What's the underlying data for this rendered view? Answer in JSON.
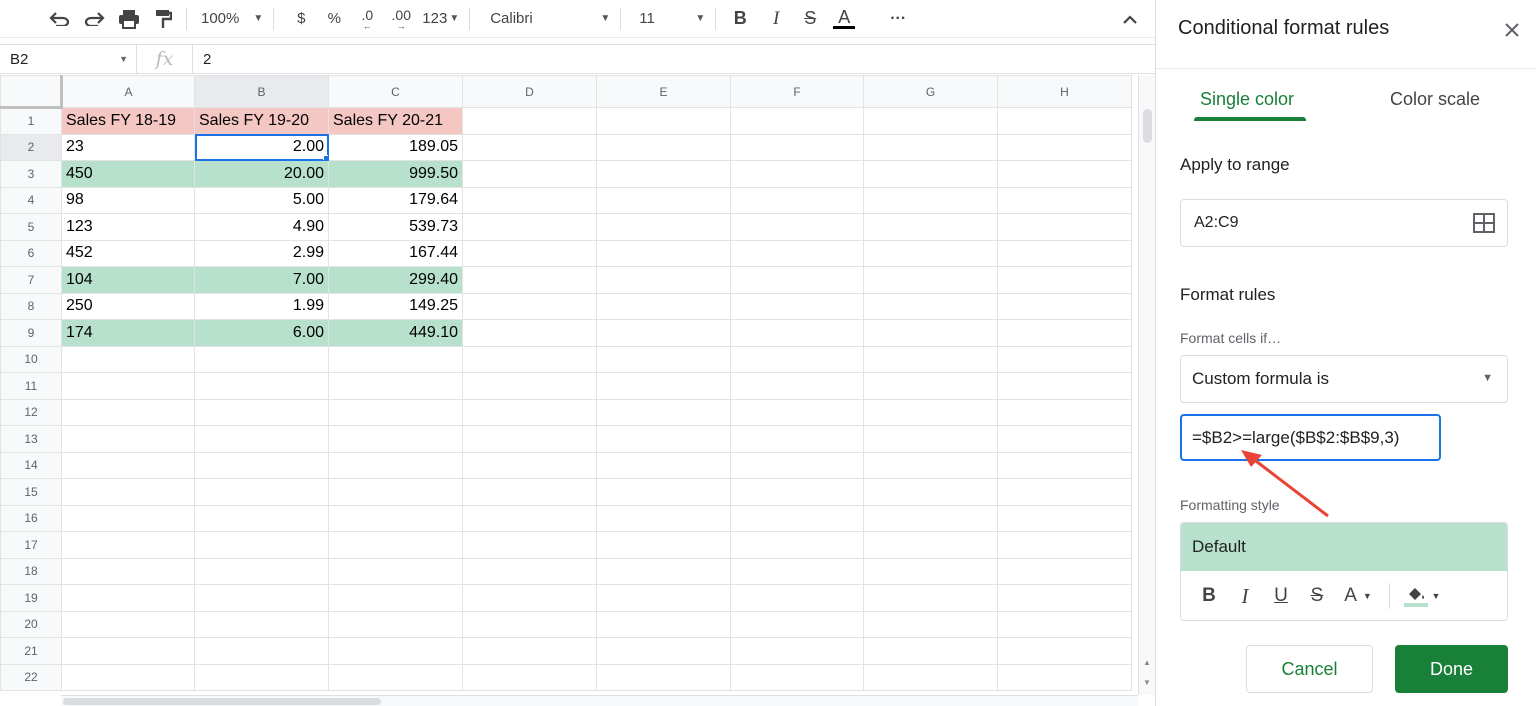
{
  "toolbar": {
    "zoom": "100%",
    "currency": "$",
    "percent": "%",
    "dec_decrease": ".0",
    "dec_increase": ".00",
    "more_formats": "123",
    "font": "Calibri",
    "font_size": "11",
    "bold": "B",
    "italic": "I",
    "strike": "S",
    "text_color": "A",
    "more": "···"
  },
  "formula_bar": {
    "cell_ref": "B2",
    "fx": "fx",
    "value": "2"
  },
  "grid": {
    "columns": [
      "A",
      "B",
      "C",
      "D",
      "E",
      "F",
      "G",
      "H"
    ],
    "row_numbers": [
      "1",
      "2",
      "3",
      "4",
      "5",
      "6",
      "7",
      "8",
      "9",
      "10",
      "11",
      "12",
      "13",
      "14",
      "15",
      "16",
      "17",
      "18",
      "19",
      "20",
      "21",
      "22"
    ],
    "header_row": [
      "Sales FY 18-19",
      "Sales  FY 19-20",
      "Sales  FY 20-21"
    ],
    "rows": [
      [
        "23",
        "2.00",
        "189.05"
      ],
      [
        "450",
        "20.00",
        "999.50"
      ],
      [
        "98",
        "5.00",
        "179.64"
      ],
      [
        "123",
        "4.90",
        "539.73"
      ],
      [
        "452",
        "2.99",
        "167.44"
      ],
      [
        "104",
        "7.00",
        "299.40"
      ],
      [
        "250",
        "1.99",
        "149.25"
      ],
      [
        "174",
        "6.00",
        "449.10"
      ]
    ],
    "highlight_color": "#b7e1cd",
    "header_color": "#f4c7c3"
  },
  "panel": {
    "title": "Conditional format rules",
    "tabs": [
      "Single color",
      "Color scale"
    ],
    "apply_to_range_label": "Apply to range",
    "range_value": "A2:C9",
    "format_rules_label": "Format rules",
    "format_cells_if_label": "Format cells if…",
    "condition": "Custom formula is",
    "formula": "=$B2>=large($B$2:$B$9,3)",
    "formatting_style_label": "Formatting style",
    "style_preview": "Default",
    "style_tools": {
      "bold": "B",
      "italic": "I",
      "underline": "U",
      "strike": "S",
      "text_color": "A"
    },
    "cancel_label": "Cancel",
    "done_label": "Done",
    "accent_color": "#188038"
  }
}
